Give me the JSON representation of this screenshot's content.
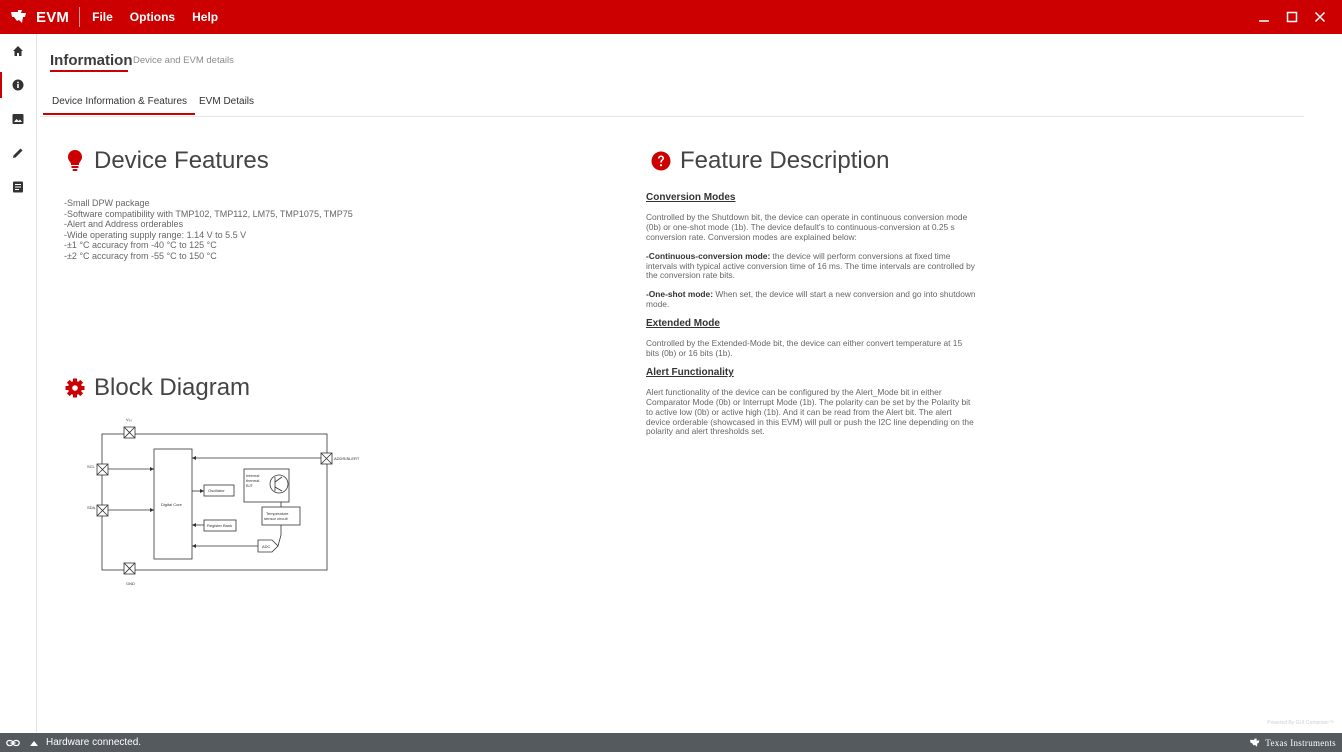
{
  "app": {
    "name": "EVM",
    "menu": [
      "File",
      "Options",
      "Help"
    ]
  },
  "header": {
    "title": "Information",
    "subtitle": "Device and EVM details"
  },
  "tabs": [
    "Device Information & Features",
    "EVM Details"
  ],
  "features": {
    "heading": "Device Features",
    "items": [
      "-Small DPW package",
      "-Software compatibility with TMP102, TMP112, LM75, TMP1075, TMP75",
      "-Alert and Address orderables",
      "-Wide operating supply range: 1.14 V to 5.5 V",
      "-±1 °C accuracy from -40 °C to 125 °C",
      "-±2 °C accuracy from -55 °C to 150 °C"
    ]
  },
  "block_diagram": {
    "heading": "Block Diagram",
    "labels": {
      "vdd": "V₀₀",
      "scl": "SCL",
      "sda": "SDA",
      "gnd": "GND",
      "addr": "ADDR/ĀLERT",
      "digital_core": "Digital Core",
      "oscillator": "Oscillator",
      "register_bank": "Register Bank",
      "internal_thermal_bjt": [
        "Internal",
        "thermal",
        "BJT"
      ],
      "temperature_sensor": [
        "Temperature",
        "sensor circuit"
      ],
      "adc": "ADC"
    }
  },
  "description": {
    "heading": "Feature Description",
    "conversion_modes": {
      "title": "Conversion Modes",
      "intro": "Controlled by the Shutdown bit, the device can operate in continuous conversion mode (0b) or one-shot mode (1b). The device default's to continuous-conversion at 0.25 s conversion rate. Conversion modes are explained below:",
      "continuous_label": "-Continuous-conversion mode:",
      "continuous_text": " the device will perform conversions at fixed time intervals with typical active conversion time of 16 ms. The time intervals are controlled by the conversion rate bits.",
      "oneshot_label": "-One-shot mode:",
      "oneshot_text": " When set, the device will start a new conversion and go into shutdown mode."
    },
    "extended_mode": {
      "title": "Extended Mode",
      "text": "Controlled by the Extended-Mode bit, the device can either convert temperature at 15 bits (0b) or 16 bits (1b)."
    },
    "alert": {
      "title": "Alert Functionality",
      "text": "Alert functionality of the device can be configured by the Alert_Mode bit in either Comparator Mode (0b) or Interrupt Mode (1b). The polarity can be set by the Polarity bit to active low (0b) or active high (1b). And it can be read from the Alert bit. The alert device orderable (showcased in this EVM) will pull or push the I2C line depending on the polarity and alert thresholds set."
    }
  },
  "statusbar": {
    "status": "Hardware connected.",
    "brand": "Texas Instruments",
    "powered": "Powered By GUI Composer™"
  },
  "colors": {
    "accent": "#cc0000",
    "statusbar": "#555a5f"
  },
  "icons": {
    "nav": [
      "home-icon",
      "info-icon",
      "image-icon",
      "pencil-icon",
      "document-icon"
    ]
  }
}
